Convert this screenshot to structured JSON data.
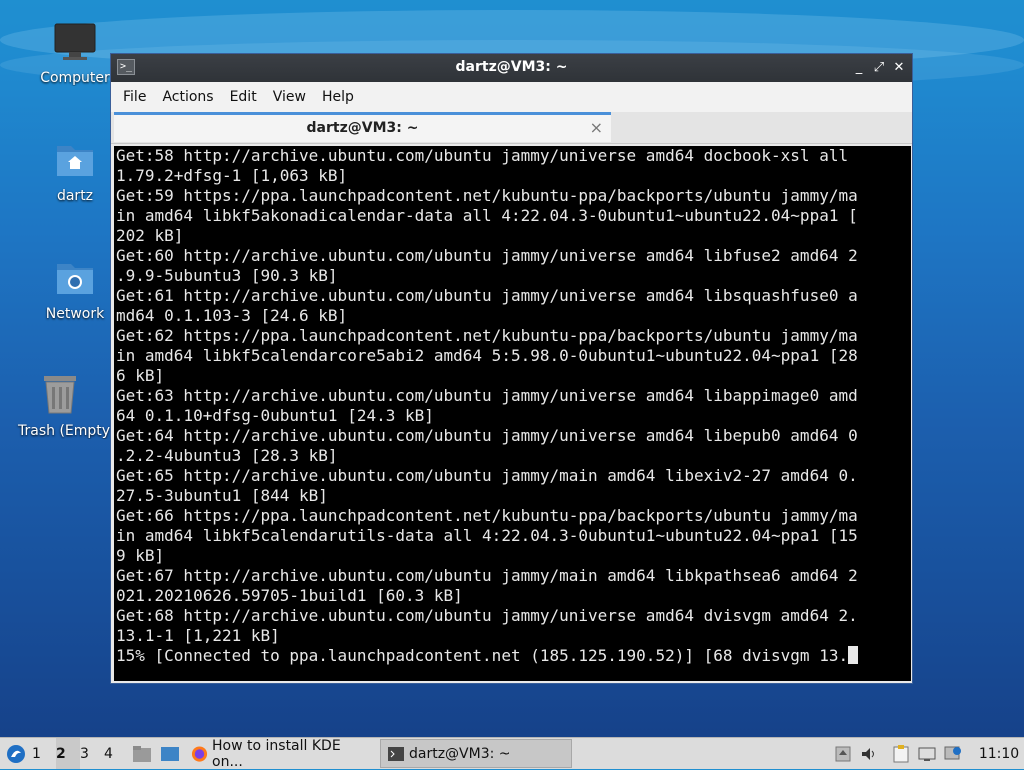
{
  "desktop": {
    "icons": [
      {
        "label": "Computer",
        "icon": "monitor-icon"
      },
      {
        "label": "dartz",
        "icon": "home-folder-icon"
      },
      {
        "label": "Network",
        "icon": "network-folder-icon"
      },
      {
        "label": "Trash (Empty)",
        "icon": "trash-icon"
      }
    ]
  },
  "window": {
    "title": "dartz@VM3: ~",
    "menu": [
      "File",
      "Actions",
      "Edit",
      "View",
      "Help"
    ],
    "tab_label": "dartz@VM3: ~",
    "tab_close": "×",
    "controls": {
      "minimize": "_",
      "maximize": "⤢",
      "close": "✕"
    }
  },
  "terminal": {
    "lines": [
      "Get:58 http://archive.ubuntu.com/ubuntu jammy/universe amd64 docbook-xsl all",
      "1.79.2+dfsg-1 [1,063 kB]",
      "Get:59 https://ppa.launchpadcontent.net/kubuntu-ppa/backports/ubuntu jammy/ma",
      "in amd64 libkf5akonadicalendar-data all 4:22.04.3-0ubuntu1~ubuntu22.04~ppa1 [",
      "202 kB]",
      "Get:60 http://archive.ubuntu.com/ubuntu jammy/universe amd64 libfuse2 amd64 2",
      ".9.9-5ubuntu3 [90.3 kB]",
      "Get:61 http://archive.ubuntu.com/ubuntu jammy/universe amd64 libsquashfuse0 a",
      "md64 0.1.103-3 [24.6 kB]",
      "Get:62 https://ppa.launchpadcontent.net/kubuntu-ppa/backports/ubuntu jammy/ma",
      "in amd64 libkf5calendarcore5abi2 amd64 5:5.98.0-0ubuntu1~ubuntu22.04~ppa1 [28",
      "6 kB]",
      "Get:63 http://archive.ubuntu.com/ubuntu jammy/universe amd64 libappimage0 amd",
      "64 0.1.10+dfsg-0ubuntu1 [24.3 kB]",
      "Get:64 http://archive.ubuntu.com/ubuntu jammy/universe amd64 libepub0 amd64 0",
      ".2.2-4ubuntu3 [28.3 kB]",
      "Get:65 http://archive.ubuntu.com/ubuntu jammy/main amd64 libexiv2-27 amd64 0.",
      "27.5-3ubuntu1 [844 kB]",
      "Get:66 https://ppa.launchpadcontent.net/kubuntu-ppa/backports/ubuntu jammy/ma",
      "in amd64 libkf5calendarutils-data all 4:22.04.3-0ubuntu1~ubuntu22.04~ppa1 [15",
      "9 kB]",
      "Get:67 http://archive.ubuntu.com/ubuntu jammy/main amd64 libkpathsea6 amd64 2",
      "021.20210626.59705-1build1 [60.3 kB]",
      "Get:68 http://archive.ubuntu.com/ubuntu jammy/universe amd64 dvisvgm amd64 2.",
      "13.1-1 [1,221 kB]"
    ],
    "status_line": "15% [Connected to ppa.launchpadcontent.net (185.125.190.52)] [68 dvisvgm 13."
  },
  "taskbar": {
    "workspaces": [
      "1",
      "2",
      "3",
      "4"
    ],
    "active_workspace": "2",
    "tasks": [
      {
        "label": "How to install KDE on...",
        "icon": "firefox-icon"
      },
      {
        "label": "dartz@VM3: ~",
        "icon": "terminal-icon"
      }
    ],
    "clock": "11:10"
  }
}
